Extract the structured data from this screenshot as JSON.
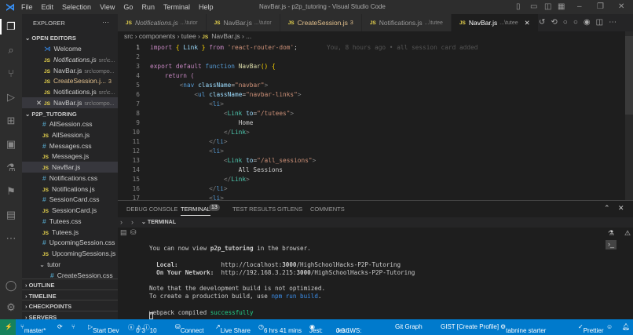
{
  "titlebar": {
    "menu": [
      "File",
      "Edit",
      "Selection",
      "View",
      "Go",
      "Run",
      "Terminal",
      "Help"
    ],
    "title": "NavBar.js - p2p_tutoring - Visual Studio Code"
  },
  "sidebar": {
    "title": "EXPLORER",
    "open_editors_label": "OPEN EDITORS",
    "open_editors": [
      {
        "name": "Welcome",
        "hint": "",
        "type": "vscode"
      },
      {
        "name": "Notifications.js",
        "hint": "src\\c...",
        "type": "js",
        "italic": true
      },
      {
        "name": "NavBar.js",
        "hint": "src\\compo...",
        "type": "js"
      },
      {
        "name": "CreateSession.j...",
        "hint": "3",
        "type": "js",
        "modified": true
      },
      {
        "name": "Notifications.js",
        "hint": "src\\c...",
        "type": "js"
      },
      {
        "name": "NavBar.js",
        "hint": "src\\compo...",
        "type": "js",
        "active": true
      }
    ],
    "project": "P2P_TUTORING",
    "files": [
      {
        "name": "AllSession.css",
        "type": "css"
      },
      {
        "name": "AllSession.js",
        "type": "js"
      },
      {
        "name": "Messages.css",
        "type": "css"
      },
      {
        "name": "Messages.js",
        "type": "js"
      },
      {
        "name": "NavBar.js",
        "type": "js",
        "selected": true
      },
      {
        "name": "Notifications.css",
        "type": "css"
      },
      {
        "name": "Notifications.js",
        "type": "js"
      },
      {
        "name": "SessionCard.css",
        "type": "css"
      },
      {
        "name": "SessionCard.js",
        "type": "js"
      },
      {
        "name": "Tutees.css",
        "type": "css"
      },
      {
        "name": "Tutees.js",
        "type": "js"
      },
      {
        "name": "UpcomingSession.css",
        "type": "css"
      },
      {
        "name": "UpcomingSessions.js",
        "type": "js"
      },
      {
        "name": "tutor",
        "type": "folder"
      },
      {
        "name": "CreateSession.css",
        "type": "css",
        "indent": true
      }
    ],
    "sections": [
      "OUTLINE",
      "TIMELINE",
      "CHECKPOINTS",
      "SERVERS"
    ]
  },
  "tabs": [
    {
      "name": "Notifications.js",
      "hint": "...\\tutor",
      "italic": true
    },
    {
      "name": "NavBar.js",
      "hint": "...\\tutor"
    },
    {
      "name": "CreateSession.js",
      "hint": "3",
      "modified": true
    },
    {
      "name": "Notifications.js",
      "hint": "...\\tutee"
    },
    {
      "name": "NavBar.js",
      "hint": "...\\tutee",
      "active": true
    }
  ],
  "breadcrumb": [
    "src",
    "components",
    "tutee",
    "NavBar.js",
    "..."
  ],
  "blame": "You, 8 hours ago • all session card added",
  "code": [
    "<span class=kw>import</span> <span class=br>{</span> <span class=at>Link</span> <span class=br>}</span> <span class=kw>from</span> <span class=st>'react-router-dom'</span>;",
    "",
    "<span class=kw>export default</span> <span class=bl>function</span> <span class=fn>NavBar</span><span class=br>()</span> <span class=br>{</span>",
    "    <span class=kw>return</span> <span class=kw>(</span>",
    "        <span class=tg>&lt;</span><span class=bl>nav</span> <span class=at>className</span>=<span class=st>\"navbar\"</span><span class=tg>&gt;</span>",
    "            <span class=tg>&lt;</span><span class=bl>ul</span> <span class=at>className</span>=<span class=st>\"navbar-links\"</span><span class=tg>&gt;</span>",
    "                <span class=tg>&lt;</span><span class=bl>li</span><span class=tg>&gt;</span>",
    "                    <span class=tg>&lt;</span><span class=tn>Link</span> <span class=at>to</span>=<span class=st>\"/tutees\"</span><span class=tg>&gt;</span>",
    "                        Home",
    "                    <span class=tg>&lt;/</span><span class=tn>Link</span><span class=tg>&gt;</span>",
    "                <span class=tg>&lt;/</span><span class=bl>li</span><span class=tg>&gt;</span>",
    "                <span class=tg>&lt;</span><span class=bl>li</span><span class=tg>&gt;</span>",
    "                    <span class=tg>&lt;</span><span class=tn>Link</span> <span class=at>to</span>=<span class=st>\"/all_sessions\"</span><span class=tg>&gt;</span>",
    "                        All Sessions",
    "                    <span class=tg>&lt;/</span><span class=tn>Link</span><span class=tg>&gt;</span>",
    "                <span class=tg>&lt;/</span><span class=bl>li</span><span class=tg>&gt;</span>",
    "                <span class=tg>&lt;</span><span class=bl>li</span><span class=tg>&gt;</span>"
  ],
  "panel": {
    "tabs": [
      "DEBUG CONSOLE",
      "TERMINAL",
      "TEST RESULTS",
      "GITLENS",
      "COMMENTS"
    ],
    "terminal_badge": "13",
    "section": "TERMINAL",
    "lines": [
      "",
      "You can now view <b>p2p_tutoring</b> in the browser.",
      "",
      "  <b>Local:</b>            http://localhost:<b>3000</b>/HighSchoolHacks-P2P-Tutoring",
      "  <b>On Your Network:</b>  http://192.168.3.215:<b>3000</b>/HighSchoolHacks-P2P-Tutoring",
      "",
      "Note that the development build is not optimized.",
      "To create a production build, use <span style='color:#3b8eea'>npm run build</span>.",
      "",
      "webpack compiled <span style='color:#23d18b'>successfully</span>"
    ]
  },
  "status": {
    "branch": "master*",
    "start_dev": "Start Dev",
    "errors": "0",
    "warnings": "3",
    "info": "10",
    "connect": "Connect",
    "live_share": "Live Share",
    "time": "6 hrs 41 mins",
    "jest": "Jest:",
    "jest_ws": "Jest-WS:",
    "jest_counts": "0  0  1",
    "git_graph": "Git Graph",
    "gist": "GIST [Create Profile]",
    "tabnine": "tabnine starter",
    "prettier": "Prettier"
  }
}
